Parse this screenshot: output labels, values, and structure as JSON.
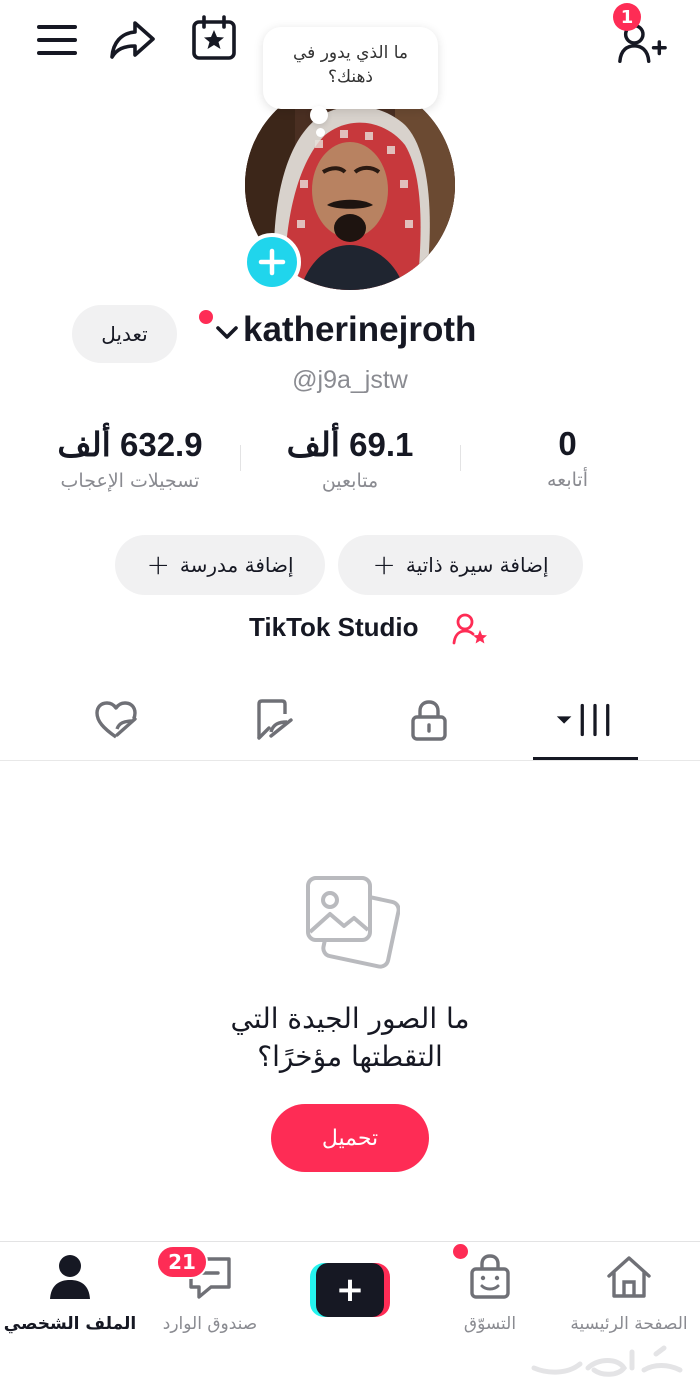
{
  "top_bar": {
    "follow_requests_badge": "1",
    "icons": [
      "menu-icon",
      "share-icon",
      "calendar-star-icon",
      "add-user-icon"
    ]
  },
  "bubble": {
    "text_line1": "ما الذي يدور في",
    "text_line2": "ذهنك؟"
  },
  "profile": {
    "edit_label": "تعديل",
    "username": "katherinejroth",
    "handle": "@j9a_jstw"
  },
  "stats": {
    "likes": {
      "value": "632.9 ألف",
      "label": "تسجيلات الإعجاب"
    },
    "followers": {
      "value": "69.1 ألف",
      "label": "متابعين"
    },
    "following": {
      "value": "0",
      "label": "أتابعه"
    }
  },
  "actions": {
    "add_bio": "إضافة سيرة ذاتية",
    "add_school": "إضافة مدرسة",
    "plus": "+"
  },
  "studio": {
    "label": "TikTok Studio"
  },
  "tabs": [
    {
      "name": "videos",
      "icon": "grid-icon",
      "active": true
    },
    {
      "name": "private",
      "icon": "lock-icon",
      "active": false
    },
    {
      "name": "reposts",
      "icon": "repost-icon",
      "active": false
    },
    {
      "name": "liked",
      "icon": "heart-hidden-icon",
      "active": false
    }
  ],
  "empty_state": {
    "line1": "ما الصور الجيدة التي",
    "line2": "التقطتها مؤخرًا؟",
    "upload_label": "تحميل"
  },
  "bottom_nav": {
    "home": "الصفحة الرئيسية",
    "shop": "التسوّق",
    "inbox": "صندوق الوارد",
    "inbox_badge": "21",
    "profile": "الملف الشخصي"
  },
  "colors": {
    "accent": "#fe2c55",
    "cyan": "#20d5ec",
    "text": "#161823",
    "muted": "#8a8b91",
    "pill_bg": "#f1f1f2"
  }
}
